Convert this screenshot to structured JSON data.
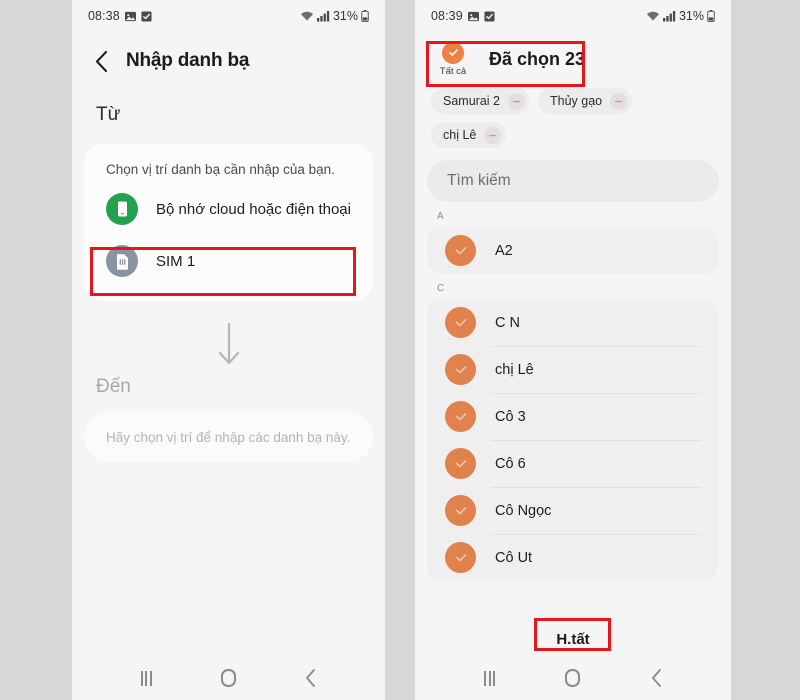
{
  "left_phone": {
    "statusbar": {
      "time": "08:38",
      "icons": [
        "image-icon",
        "checkbox-icon"
      ],
      "wifi": "wifi-icon",
      "signal": "signal-icon",
      "battery_pct": "31%",
      "battery": "battery-icon"
    },
    "appbar": {
      "back": "back-chevron-icon",
      "title": "Nhập danh bạ"
    },
    "from_label": "Từ",
    "card": {
      "caption": "Chọn vị trí danh bạ cần nhập của bạn.",
      "options": [
        {
          "icon": "phone-storage-icon",
          "label": "Bộ nhớ cloud hoặc điện thoại",
          "icon_color": "#24a14f"
        },
        {
          "icon": "sim-card-icon",
          "label": "SIM 1",
          "icon_color": "#8a93a3"
        }
      ]
    },
    "arrow": "arrow-down-icon",
    "to_label": "Đến",
    "destination_placeholder": "Hãy chọn vị trí để nhập các danh bạ này.",
    "navbar": {
      "recents": "recents-icon",
      "home": "home-icon",
      "back": "back-icon"
    }
  },
  "right_phone": {
    "statusbar": {
      "time": "08:39",
      "icons": [
        "image-icon",
        "checkbox-icon"
      ],
      "wifi": "wifi-icon",
      "signal": "signal-icon",
      "battery_pct": "31%",
      "battery": "battery-icon"
    },
    "select_header": {
      "select_all_label": "Tất cả",
      "select_all_checked": true,
      "title": "Đã chọn 23"
    },
    "chips": [
      {
        "label": "Samurai 2",
        "remove": "minus-circle-icon"
      },
      {
        "label": "Thủy gạo",
        "remove": "minus-circle-icon"
      },
      {
        "label": "chị Lê",
        "remove": "minus-circle-icon"
      }
    ],
    "search_placeholder": "Tìm kiếm",
    "groups": [
      {
        "letter": "A",
        "contacts": [
          {
            "name": "A2",
            "checked": true
          }
        ]
      },
      {
        "letter": "C",
        "contacts": [
          {
            "name": "C N",
            "checked": true
          },
          {
            "name": "chị Lê",
            "checked": true
          },
          {
            "name": "Cô 3",
            "checked": true
          },
          {
            "name": "Cô 6",
            "checked": true
          },
          {
            "name": "Cô Ngọc",
            "checked": true
          },
          {
            "name": "Cô Ut",
            "checked": true
          }
        ]
      }
    ],
    "done_label": "H.tất",
    "navbar": {
      "recents": "recents-icon",
      "home": "home-icon",
      "back": "back-icon"
    }
  },
  "annotations": {
    "highlight_color": "#e8161a",
    "boxes": [
      "sim-1-row",
      "selected-count-header",
      "done-button"
    ]
  }
}
